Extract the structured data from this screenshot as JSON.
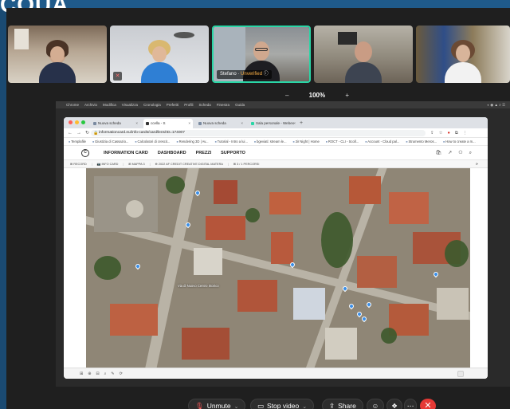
{
  "brand": {
    "text": "CQUA"
  },
  "tiles": [
    {
      "name": "",
      "muted": false
    },
    {
      "name": "",
      "muted": true
    },
    {
      "name": "Stefano",
      "status": "Unverified"
    },
    {
      "name": ""
    },
    {
      "name": ""
    }
  ],
  "zoom": {
    "minus": "–",
    "value": "100%",
    "plus": "+"
  },
  "mac_menu": {
    "apple": "",
    "items": [
      "Chrome",
      "Archivio",
      "Modifica",
      "Visualizza",
      "Cronologia",
      "Preferiti",
      "Profili",
      "Scheda",
      "Finestra",
      "Guida"
    ],
    "right": "◐ ◉ ▲ ⌕ ☰"
  },
  "browser": {
    "tabs": [
      {
        "label": "Nuova scheda"
      },
      {
        "label": "ccella - S"
      },
      {
        "label": "Nuova scheda"
      },
      {
        "label": "Sala personale - Webex"
      }
    ],
    "new_tab": "+",
    "nav": {
      "back": "←",
      "forward": "→",
      "reload": "↻"
    },
    "url": "informationcard.eu/info-cards/card/lens/ID=174007",
    "url_icons": {
      "share": "⇪",
      "star": "☆",
      "stop": "●",
      "ext": "⧉",
      "menu": "⋮"
    },
    "bookmarks": [
      "Templafile",
      "Giustizia di Cassazio...",
      "Calcolatori di crescit...",
      "Rendering 3D | Av...",
      "Tutorial - Intro a lui...",
      "bgeviati: stream le...",
      "3ir Night | Home",
      "ROCT - CLI - Scoll...",
      "Account - Cloud pal...",
      "Strumento Meros...",
      "How to create a m..."
    ]
  },
  "site": {
    "logo": "C",
    "menu": [
      "INFORMATION CARD",
      "DASHBOARD",
      "PREZZI",
      "SUPPORTO"
    ],
    "icons": {
      "cart": "🛍",
      "share": "↗",
      "user": "⚇",
      "search": "⌕"
    },
    "subnav": [
      "⊞ RECORD",
      "📷 INFO CARD",
      "⊞ MAPPA 3",
      "⊕ 2022 AF CREDIT CREATIVE DIGITAL MATERA",
      "⊞ 3 / 1 PERCORSI"
    ],
    "subnav_end": "⟳"
  },
  "map": {
    "label": "Via di Nuovo Centro Storico"
  },
  "map_tools": [
    "⊞",
    "⊕",
    "⊟",
    "⌕",
    "✎",
    "⟳"
  ],
  "controls": {
    "unmute": "Unmute",
    "stop_video": "Stop video",
    "share": "Share",
    "reactions": "☺",
    "apps": "❖",
    "more": "⋯",
    "leave": "✕"
  },
  "colors": {
    "brand_blue": "#1a4a72",
    "webex_dark": "#1f1f1f",
    "active_speaker": "#2ad6a6",
    "leave_red": "#e53935",
    "pin_blue": "#3b8fe8"
  }
}
